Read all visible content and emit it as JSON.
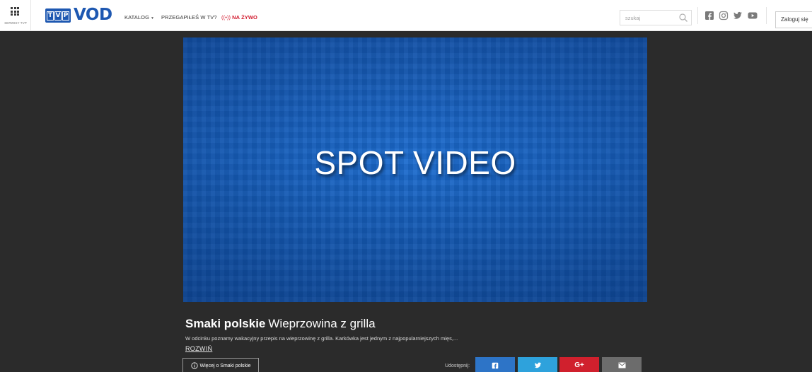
{
  "header": {
    "services_label": "SERWISY TVP",
    "logo": {
      "tvp_letters": [
        "T",
        "V",
        "P"
      ],
      "vod_text": "VOD",
      "brand_color": "#1e58b1"
    },
    "nav": {
      "katalog": "KATALOG",
      "przegapiles": "PRZEGAPIŁEŚ W TV?",
      "live_icon": "((•))",
      "live": "NA ŻYWO"
    },
    "search": {
      "placeholder": "szukaj",
      "value": ""
    },
    "social": [
      "facebook-icon",
      "instagram-icon",
      "twitter-icon",
      "youtube-icon"
    ],
    "login": "Zaloguj się"
  },
  "player": {
    "overlay_text": "SPOT VIDEO",
    "base_color": "#1a64c4"
  },
  "episode": {
    "series": "Smaki polskie",
    "title": "Wieprzowina z grilla",
    "description": "W odcinku poznamy wakacyjny przepis na wieprzowinę z grilla. Karkówka jest jednym z najpopularniejszych mięs,...",
    "expand": "ROZWIŃ",
    "more_button": "Więcej o Smaki polskie"
  },
  "share": {
    "label": "Udostępnij:",
    "buttons": [
      {
        "name": "facebook",
        "color": "#2d74c7"
      },
      {
        "name": "twitter",
        "color": "#2ea2dc"
      },
      {
        "name": "google-plus",
        "text": "G+",
        "color": "#d0202d"
      },
      {
        "name": "email",
        "color": "#6c6c6c"
      }
    ]
  }
}
